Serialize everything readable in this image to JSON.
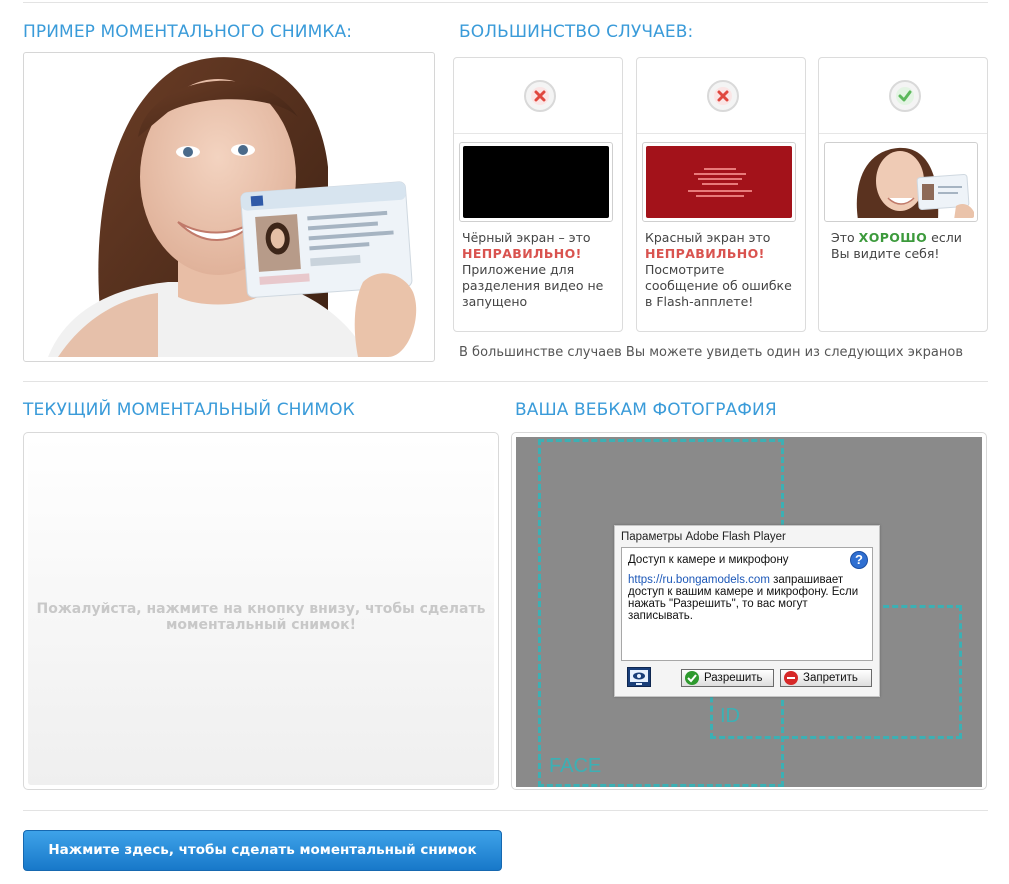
{
  "sample": {
    "title": "ПРИМЕР МОМЕНТАЛЬНОГО СНИМКА:",
    "photo_alt": "sample-id-photo"
  },
  "cases": {
    "title": "БОЛЬШИНСТВО СЛУЧАЕВ:",
    "items": [
      {
        "status": "wrong",
        "icon": "red-x-icon",
        "text_before": "Чёрный экран – это",
        "highlight": "НЕПРАВИЛЬНО!",
        "text_after": "Приложение для разделения видео не запущено"
      },
      {
        "status": "wrong",
        "icon": "red-x-icon",
        "text_before": "Красный экран это",
        "highlight": "НЕПРАВИЛЬНО!",
        "text_after": "Посмотрите сообщение об ошибке в Flash-апплете!"
      },
      {
        "status": "right",
        "icon": "green-check-icon",
        "text_before": "Это",
        "highlight": "ХОРОШО",
        "text_after": "если Вы видите себя!"
      }
    ],
    "note": "В большинстве случаев Вы можете увидеть один из следующих экранов"
  },
  "current": {
    "title": "ТЕКУЩИЙ МОМЕНТАЛЬНЫЙ СНИМОК",
    "placeholder": "Пожалуйста, нажмите на кнопку внизу, чтобы сделать моментальный снимок!"
  },
  "webcam": {
    "title": "ВАША ВЕБКАМ ФОТОГРАФИЯ",
    "face_label": "FACE",
    "id_label": "ID",
    "flash_dialog": {
      "title": "Параметры Adobe Flash Player",
      "heading": "Доступ к камере и микрофону",
      "link": "https://ru.bongamodels.com",
      "text": "запрашивает доступ к вашим камере и микрофону. Если нажать \"Разрешить\", то вас могут записывать.",
      "allow_label": "Разрешить",
      "deny_label": "Запретить",
      "help_label": "?"
    }
  },
  "cta": {
    "label": "Нажмите здесь, чтобы сделать моментальный снимок"
  },
  "colors": {
    "accent": "#3a9bd9",
    "wrong": "#d9534f",
    "right": "#3c9a3c",
    "button": "#1f84d6",
    "guide": "#3cb0b4"
  }
}
